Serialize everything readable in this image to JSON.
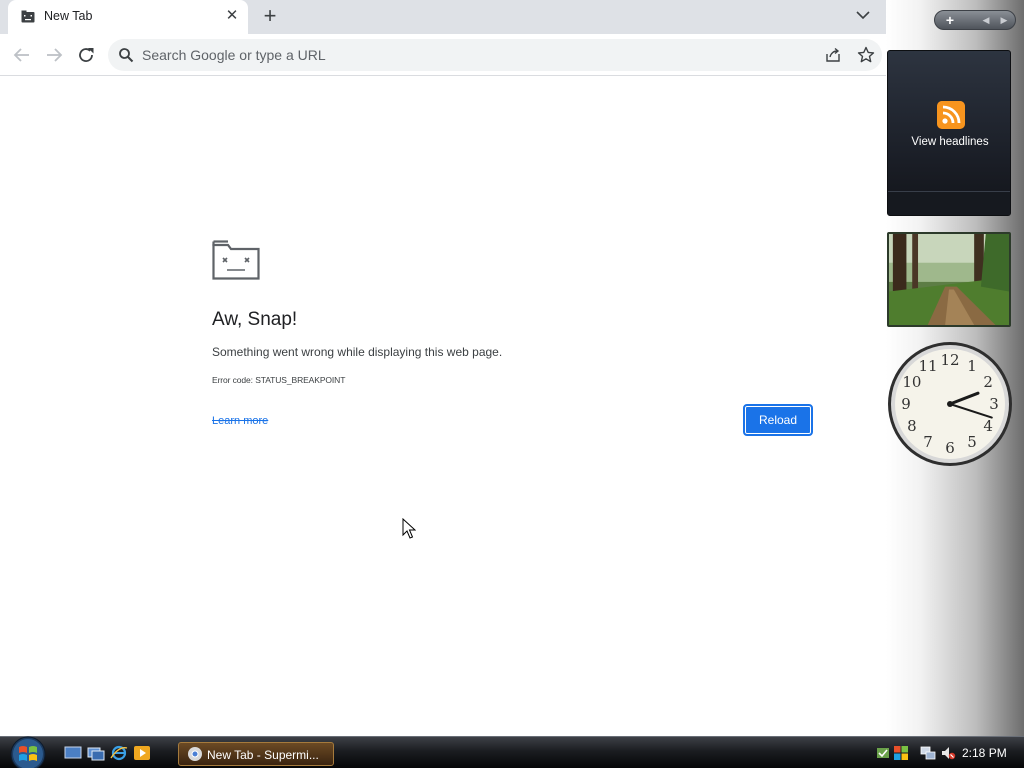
{
  "browser": {
    "tab": {
      "title": "New Tab",
      "close_glyph": "✕",
      "favicon": "sad-tab-icon"
    },
    "new_tab_glyph": "+",
    "omnibox": {
      "placeholder": "Search Google or type a URL"
    }
  },
  "error_page": {
    "heading": "Aw, Snap!",
    "message": "Something went wrong while displaying this web page.",
    "error_code": "Error code: STATUS_BREAKPOINT",
    "learn_more": "Learn more",
    "reload_label": "Reload"
  },
  "sidebar": {
    "add_glyph": "+",
    "prev_glyph": "◀",
    "next_glyph": "▶",
    "feed_gadget": {
      "label": "View headlines",
      "icon": "rss-feed-icon"
    },
    "clock": {
      "numerals": [
        "12",
        "1",
        "2",
        "3",
        "4",
        "5",
        "6",
        "7",
        "8",
        "9",
        "10",
        "11"
      ],
      "hour": 2,
      "minute": 18
    }
  },
  "taskbar": {
    "task_button_label": "New Tab - Supermi...",
    "clock_text": "2:18 PM",
    "quick_launch": [
      "show-desktop-icon",
      "switch-windows-icon",
      "internet-explorer-icon",
      "media-player-icon"
    ],
    "tray": [
      "windows-update-icon",
      "security-center-icon",
      "network-icon",
      "volume-muted-icon"
    ]
  },
  "colors": {
    "accent": "#1a73e8",
    "tab_strip": "#dee1e6",
    "omnibox": "#f1f3f4",
    "feed_orange": "#f7941e"
  }
}
